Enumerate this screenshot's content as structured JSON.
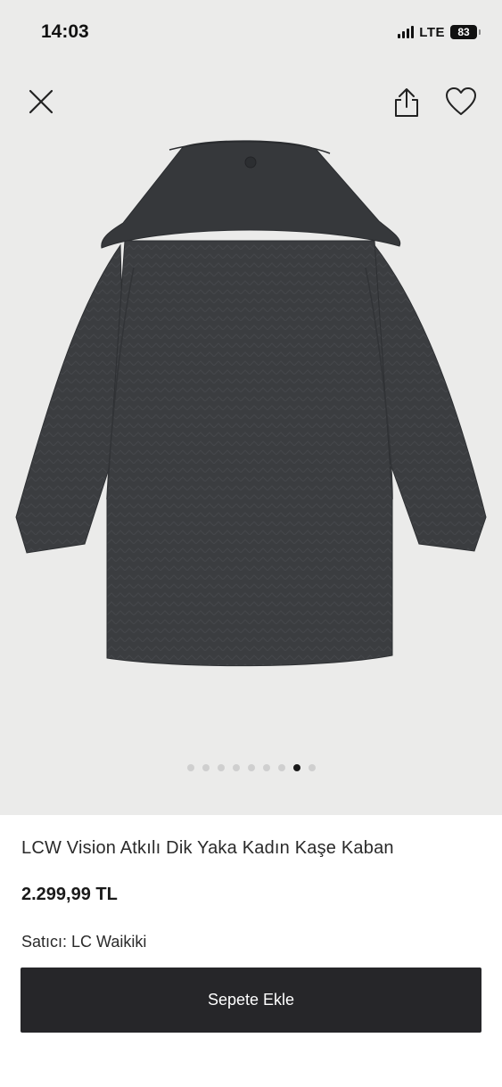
{
  "status_bar": {
    "time": "14:03",
    "network": "LTE",
    "battery": "83"
  },
  "icons": {
    "close": "close-icon",
    "share": "share-icon",
    "favorite": "heart-icon"
  },
  "gallery": {
    "total_images": 9,
    "active_index": 7
  },
  "product": {
    "title": "LCW Vision Atkılı Dik Yaka Kadın Kaşe Kaban",
    "price": "2.299,99 TL",
    "seller_label": "Satıcı:",
    "seller_name": "LC Waikiki"
  },
  "actions": {
    "add_to_cart": "Sepete Ekle"
  },
  "colors": {
    "button_bg": "#262629",
    "photo_bg": "#ebebea",
    "coat": "#3b3d40"
  }
}
